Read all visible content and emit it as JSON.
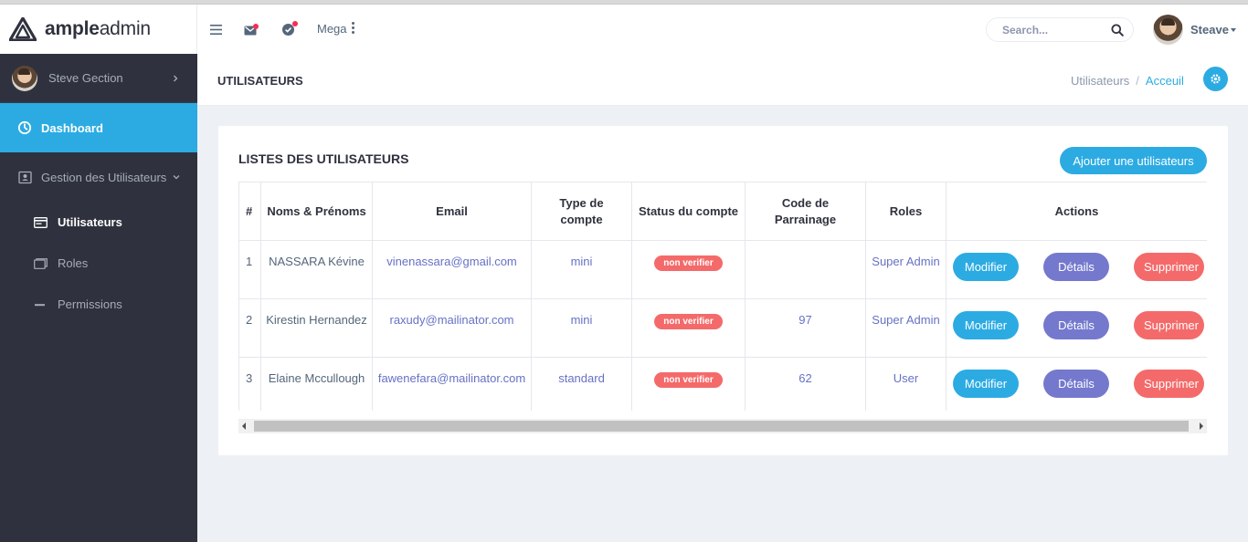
{
  "brand": {
    "bold": "ample",
    "light": "admin"
  },
  "topbar": {
    "mega_label": "Mega",
    "search_placeholder": "Search...",
    "user_name": "Steave"
  },
  "sidebar": {
    "user_name": "Steve Gection",
    "dashboard_label": "Dashboard",
    "group_label": "Gestion des Utilisateurs",
    "items": [
      {
        "label": "Utilisateurs",
        "active": true
      },
      {
        "label": "Roles"
      },
      {
        "label": "Permissions"
      }
    ]
  },
  "pagebar": {
    "title": "UTILISATEURS",
    "breadcrumb": [
      "Utilisateurs",
      "Acceuil"
    ]
  },
  "card": {
    "title": "LISTES DES UTILISATEURS",
    "add_button": "Ajouter une utilisateurs",
    "columns": [
      "#",
      "Noms & Prénoms",
      "Email",
      "Type de compte",
      "Status du compte",
      "Code de Parrainage",
      "Roles",
      "Actions"
    ],
    "rows": [
      {
        "num": "1",
        "name": "NASSARA Kévine",
        "email": "vinenassara@gmail.com",
        "type": "mini",
        "status": "non verifier",
        "code": "",
        "role": "Super Admin"
      },
      {
        "num": "2",
        "name": "Kirestin Hernandez",
        "email": "raxudy@mailinator.com",
        "type": "mini",
        "status": "non verifier",
        "code": "97",
        "role": "Super Admin"
      },
      {
        "num": "3",
        "name": "Elaine Mccullough",
        "email": "fawenefara@mailinator.com",
        "type": "standard",
        "status": "non verifier",
        "code": "62",
        "role": "User"
      }
    ],
    "actions": {
      "edit": "Modifier",
      "details": "Détails",
      "delete": "Supprimer"
    }
  },
  "colors": {
    "primary": "#2cabe3",
    "details": "#7479cd",
    "danger": "#f46a6a",
    "sidebar": "#2f323e",
    "link": "#6672c4"
  }
}
